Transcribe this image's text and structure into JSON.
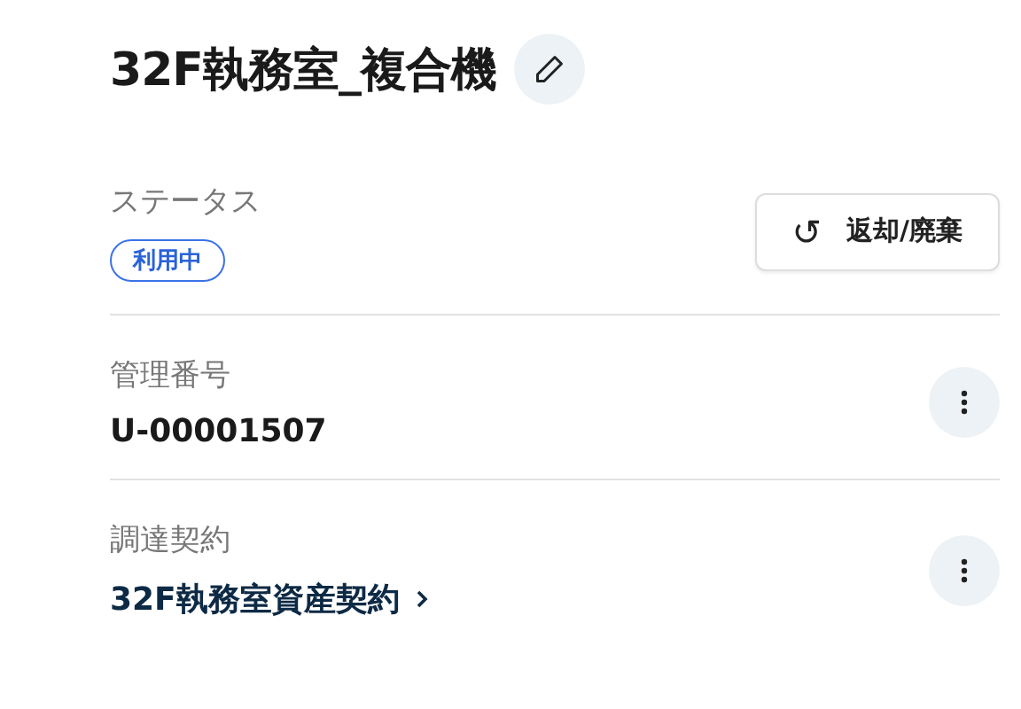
{
  "title": "32F執務室_複合機",
  "status": {
    "label": "ステータス",
    "badge": "利用中"
  },
  "action_button": {
    "icon": "↺",
    "label": "返却/廃棄"
  },
  "fields": [
    {
      "kind": "text",
      "label": "管理番号",
      "value": "U-00001507"
    },
    {
      "kind": "link",
      "label": "調達契約",
      "value": "32F執務室資産契約"
    }
  ]
}
